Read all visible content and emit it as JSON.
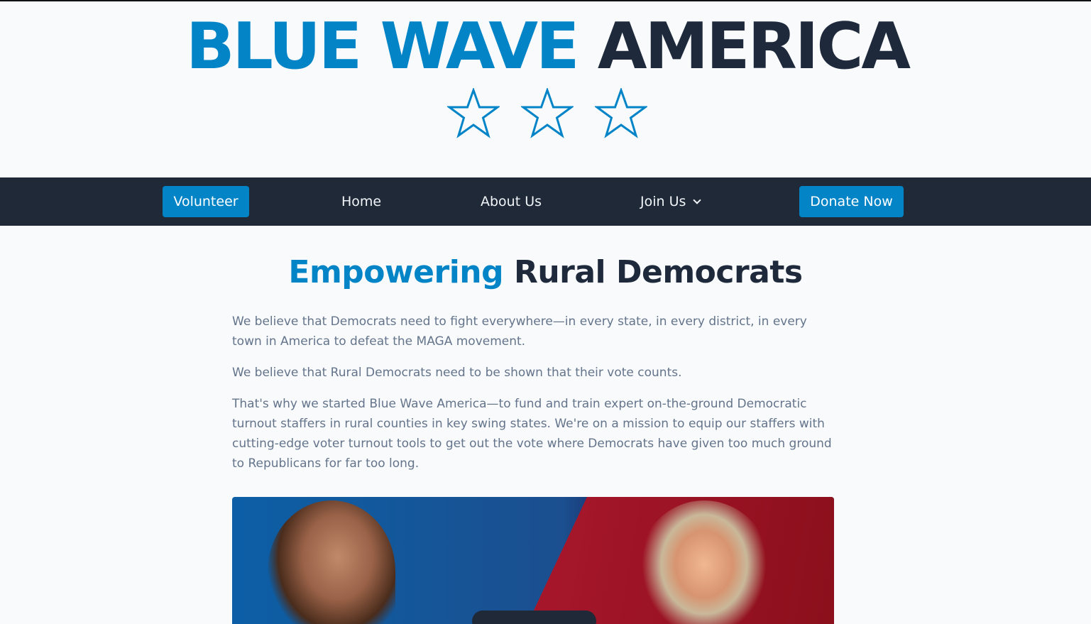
{
  "brand": {
    "part1": "BLUE WAVE",
    "part2": "AMERICA",
    "stars": [
      "star-icon",
      "star-icon",
      "star-icon"
    ]
  },
  "nav": {
    "volunteer": "Volunteer",
    "home": "Home",
    "about": "About Us",
    "join": "Join Us",
    "donate": "Donate Now"
  },
  "hero": {
    "title_accent": "Empowering",
    "title_rest": "Rural Democrats",
    "paragraphs": [
      "We believe that Democrats need to fight everywhere—in every state, in every district, in every town in America to defeat the MAGA movement.",
      "We believe that Rural Democrats need to be shown that their vote counts.",
      "That's why we started Blue Wave America—to fund and train expert on-the-ground Democratic turnout staffers in rural counties in key swing states. We're on a mission to equip our staffers with cutting-edge voter turnout tools to get out the vote where Democrats have given too much ground to Republicans for far too long."
    ]
  },
  "colors": {
    "accent": "#0284c7",
    "dark": "#1e293b",
    "nav_bg": "#1f2937",
    "body_text": "#64748b"
  }
}
